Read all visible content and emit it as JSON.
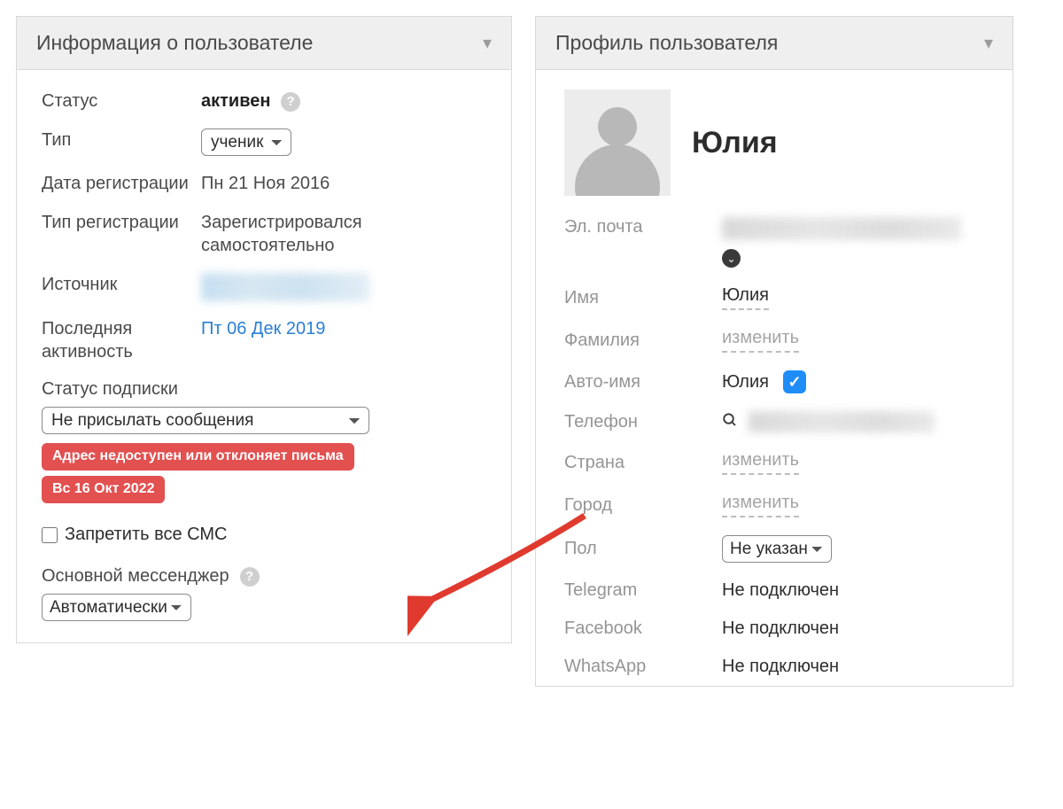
{
  "left": {
    "title": "Информация о пользователе",
    "status_label": "Статус",
    "status_value": "активен",
    "type_label": "Тип",
    "type_value": "ученик",
    "regdate_label": "Дата регистрации",
    "regdate_value": "Пн 21 Ноя 2016",
    "regtype_label": "Тип регистрации",
    "regtype_value": "Зарегистрировался самостоятельно",
    "source_label": "Источник",
    "lastact_label": "Последняя активность",
    "lastact_value": "Пт 06 Дек 2019",
    "substatus_label": "Статус подписки",
    "substatus_value": "Не присылать сообщения",
    "badge1": "Адрес недоступен или отклоняет письма",
    "badge2": "Вс 16 Окт 2022",
    "blocksms_label": "Запретить все СМС",
    "mainmsg_label": "Основной мессенджер",
    "mainmsg_value": "Автоматически"
  },
  "right": {
    "title": "Профиль пользователя",
    "name": "Юлия",
    "email_label": "Эл. почта",
    "firstname_label": "Имя",
    "firstname_value": "Юлия",
    "lastname_label": "Фамилия",
    "lastname_placeholder": "изменить",
    "autoname_label": "Авто-имя",
    "autoname_value": "Юлия",
    "phone_label": "Телефон",
    "country_label": "Страна",
    "country_placeholder": "изменить",
    "city_label": "Город",
    "city_placeholder": "изменить",
    "gender_label": "Пол",
    "gender_value": "Не указан",
    "telegram_label": "Telegram",
    "telegram_value": "Не подключен",
    "facebook_label": "Facebook",
    "facebook_value": "Не подключен",
    "whatsapp_label": "WhatsApp",
    "whatsapp_value": "Не подключен"
  }
}
